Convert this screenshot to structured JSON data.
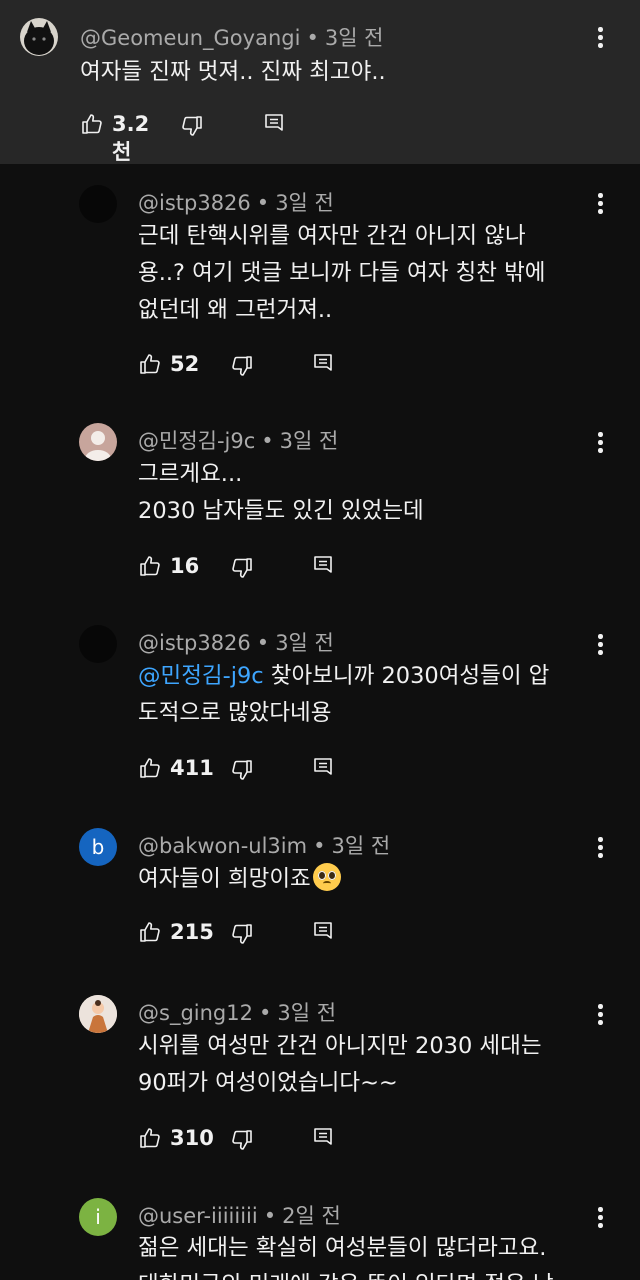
{
  "separator": "•",
  "comments": [
    {
      "handle": "@Geomeun_Goyangi",
      "time": "3일 전",
      "lines": [
        "여자들 진짜 멋져.. 진짜 최고야.."
      ],
      "likes": "3.2천",
      "avatar": {
        "type": "cat",
        "color": "#1a1a1a"
      }
    },
    {
      "handle": "@istp3826",
      "time": "3일 전",
      "lines": [
        "근데 탄핵시위를 여자만 간건 아니지 않나",
        "용..? 여기 댓글 보니까 다들 여자 칭찬 밖에",
        "없던데 왜 그런거져.."
      ],
      "likes": "52",
      "avatar": {
        "type": "blank",
        "color": "#070707"
      }
    },
    {
      "handle": "@민정김-j9c",
      "time": "3일 전",
      "lines": [
        "그르게요...",
        "2030 남자들도 있긴 있었는데"
      ],
      "likes": "16",
      "avatar": {
        "type": "person",
        "color": "#c7a59c"
      }
    },
    {
      "handle": "@istp3826",
      "time": "3일 전",
      "mention": "@민정김-j9c",
      "lines": [
        " 찾아보니까 2030여성들이 압",
        "도적으로 많았다네용"
      ],
      "likes": "411",
      "avatar": {
        "type": "blank",
        "color": "#070707"
      }
    },
    {
      "handle": "@bakwon-ul3im",
      "time": "3일 전",
      "lines": [
        "여자들이 희망이죠"
      ],
      "emoji": "pleading-face",
      "likes": "215",
      "avatar": {
        "type": "letter",
        "letter": "b",
        "color": "#1565c0"
      }
    },
    {
      "handle": "@s_ging12",
      "time": "3일 전",
      "lines": [
        "시위를 여성만 간건 아니지만 2030 세대는",
        "90퍼가 여성이었습니다~~"
      ],
      "likes": "310",
      "avatar": {
        "type": "photo",
        "color": "#e9dcd2"
      }
    },
    {
      "handle": "@user-iiiiiiii",
      "time": "2일 전",
      "lines": [
        "젊은 세대는 확실히 여성분들이 많더라고요.",
        "대한민국의 미래에 같은 뜻이 있다면 젊은 남"
      ],
      "avatar": {
        "type": "letter",
        "letter": "i",
        "color": "#7cb342"
      }
    }
  ],
  "icons": {
    "like": "thumbs-up-icon",
    "dislike": "thumbs-down-icon",
    "reply": "reply-icon",
    "more": "more-vert-icon"
  }
}
